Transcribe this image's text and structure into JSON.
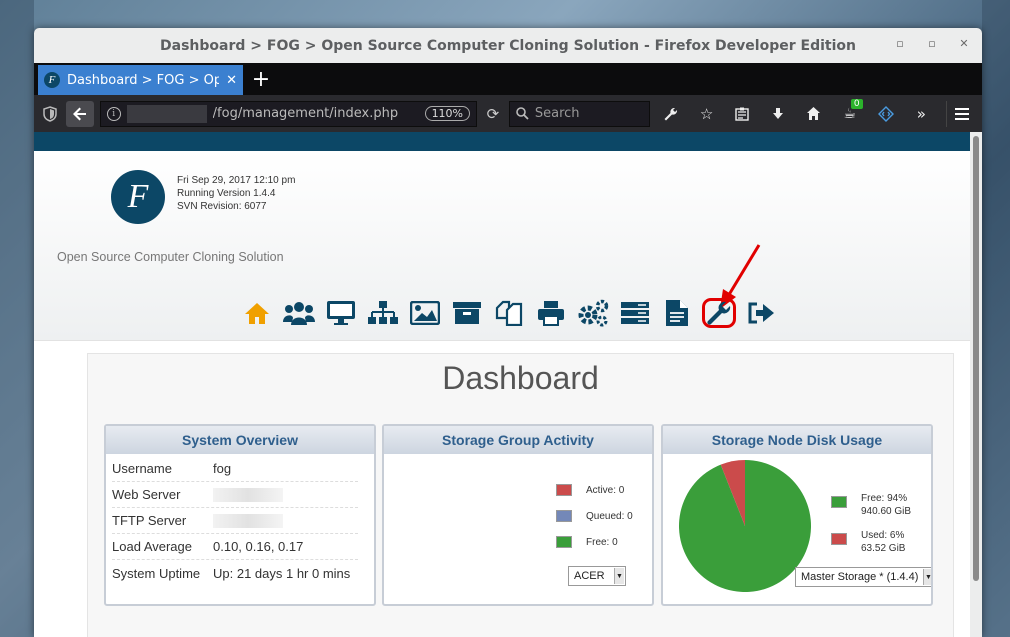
{
  "window": {
    "title": "Dashboard > FOG > Open Source Computer Cloning Solution - Firefox Developer Edition",
    "controls": {
      "minimize": "▫",
      "maximize": "▫",
      "close": "✕"
    }
  },
  "tab": {
    "title": "Dashboard > FOG > Open",
    "favicon_letter": "F",
    "close": "✕"
  },
  "new_tab": "+",
  "navbar": {
    "url": "/fog/management/index.php",
    "zoom": "110%",
    "search_placeholder": "Search",
    "addon_badge": "0"
  },
  "page": {
    "logo_letter": "F",
    "datetime": "Fri Sep 29, 2017 12:10 pm",
    "version": "Running Version 1.4.4",
    "svn": "SVN Revision: 6077",
    "tagline": "Open Source Computer Cloning Solution",
    "menu_icons": [
      "home-icon",
      "users-icon",
      "monitor-icon",
      "sitemap-icon",
      "image-icon",
      "archive-icon",
      "copy-icon",
      "print-icon",
      "cogs-icon",
      "server-icon",
      "report-icon",
      "wrench-icon",
      "logout-icon"
    ],
    "dashboard_title": "Dashboard"
  },
  "system_overview": {
    "title": "System Overview",
    "rows": [
      {
        "key": "Username",
        "value": "fog"
      },
      {
        "key": "Web Server",
        "value": ""
      },
      {
        "key": "TFTP Server",
        "value": ""
      },
      {
        "key": "Load Average",
        "value": "0.10, 0.16, 0.17"
      },
      {
        "key": "System Uptime",
        "value": "Up: 21 days 1 hr 0 mins"
      }
    ]
  },
  "storage_group": {
    "title": "Storage Group Activity",
    "legend": [
      {
        "label": "Active: 0",
        "color": "#cb4b4b"
      },
      {
        "label": "Queued: 0",
        "color": "#7488b8"
      },
      {
        "label": "Free: 0",
        "color": "#3a9e3a"
      }
    ],
    "select": "ACER"
  },
  "storage_node": {
    "title": "Storage Node Disk Usage",
    "free_label": "Free: 94%",
    "free_value": "940.60 GiB",
    "used_label": "Used: 6%",
    "used_value": "63.52 GiB",
    "free_color": "#3a9e3a",
    "used_color": "#cb4b4b",
    "free_fraction": 0.94,
    "used_fraction": 0.06,
    "select": "Master Storage * (1.4.4)"
  }
}
